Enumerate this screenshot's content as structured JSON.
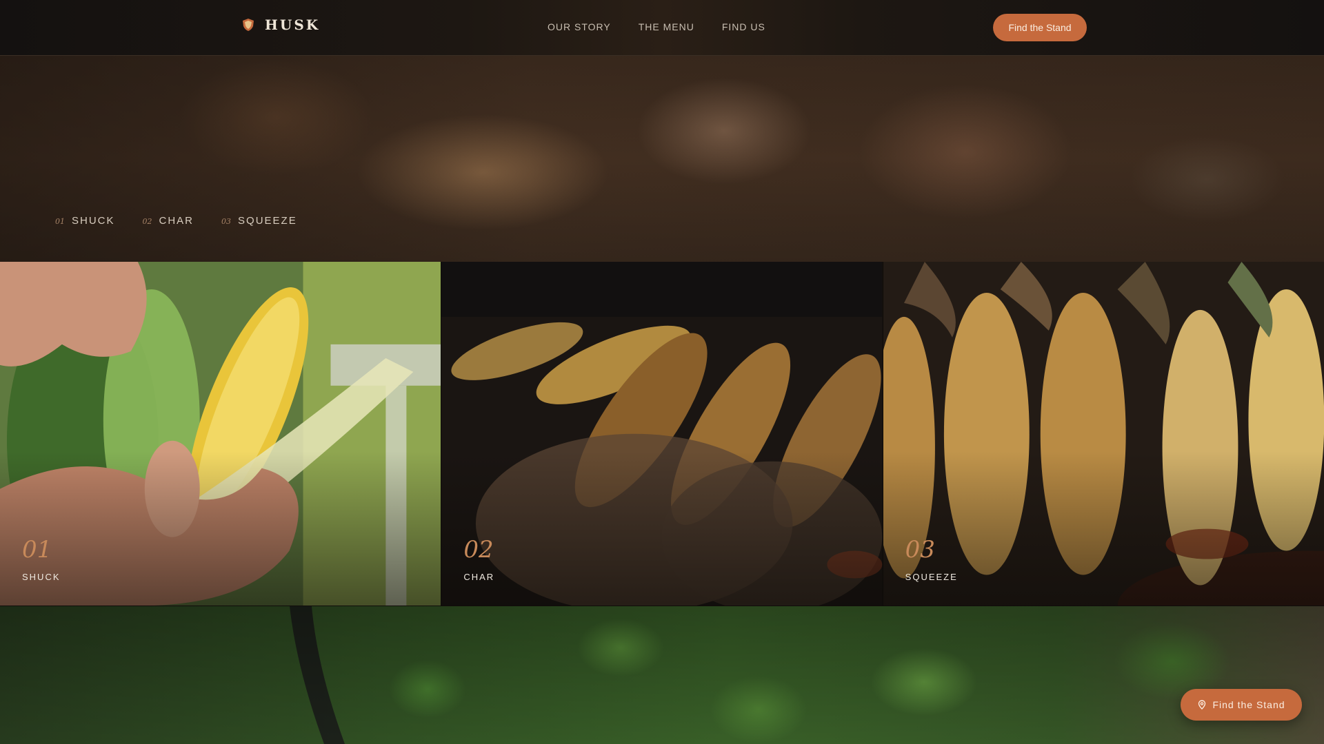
{
  "brand": {
    "name": "HUSK"
  },
  "nav": {
    "links": [
      "OUR STORY",
      "THE MENU",
      "FIND US"
    ],
    "cta_label": "Find the Stand"
  },
  "hero": {
    "steps": [
      {
        "num": "01",
        "label": "SHUCK"
      },
      {
        "num": "02",
        "label": "CHAR"
      },
      {
        "num": "03",
        "label": "SQUEEZE"
      }
    ]
  },
  "panels": [
    {
      "num": "01",
      "label": "SHUCK"
    },
    {
      "num": "02",
      "label": "CHAR"
    },
    {
      "num": "03",
      "label": "SQUEEZE"
    }
  ],
  "floating_cta": {
    "label": "Find the Stand",
    "icon": "map-pin-icon"
  },
  "colors": {
    "accent": "#c66a3d",
    "background": "#17120e",
    "text": "#efe6d8"
  }
}
